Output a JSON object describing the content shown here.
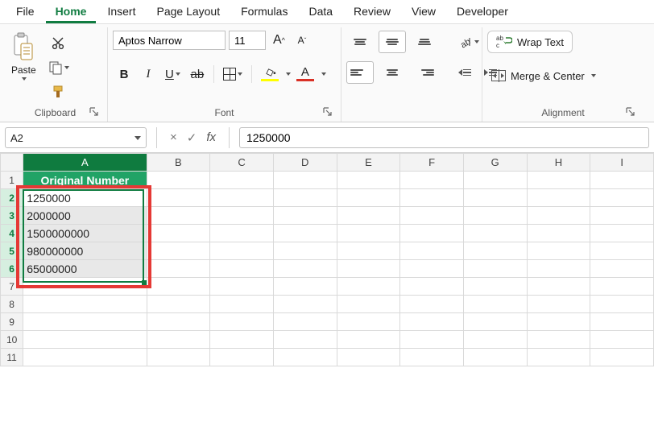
{
  "tabs": {
    "file": "File",
    "home": "Home",
    "insert": "Insert",
    "page_layout": "Page Layout",
    "formulas": "Formulas",
    "data": "Data",
    "review": "Review",
    "view": "View",
    "developer": "Developer",
    "active": "Home"
  },
  "ribbon": {
    "clipboard": {
      "paste": "Paste",
      "label": "Clipboard"
    },
    "font": {
      "label": "Font",
      "font_name": "Aptos Narrow",
      "font_size": "11",
      "bold": "B",
      "italic": "I",
      "underline": "U",
      "strike": "ab",
      "grow": "A",
      "shrink": "A",
      "fontcolor": "A"
    },
    "alignment": {
      "label": "Alignment",
      "wrap_text": "Wrap Text",
      "merge_center": "Merge & Center",
      "ab_prefix": "ab"
    }
  },
  "formula_bar": {
    "name_box": "A2",
    "cancel": "×",
    "confirm": "✓",
    "fx": "fx",
    "formula": "1250000"
  },
  "grid": {
    "columns": [
      "A",
      "B",
      "C",
      "D",
      "E",
      "F",
      "G",
      "H",
      "I"
    ],
    "active_column": "A",
    "rows": [
      1,
      2,
      3,
      4,
      5,
      6,
      7,
      8,
      9,
      10,
      11
    ],
    "selected_rows": [
      2,
      3,
      4,
      5,
      6
    ],
    "header_cell": "Original Number",
    "data": [
      "1250000",
      "2000000",
      "1500000000",
      "980000000",
      "65000000"
    ],
    "selection": {
      "start": "A2",
      "end": "A6"
    }
  }
}
